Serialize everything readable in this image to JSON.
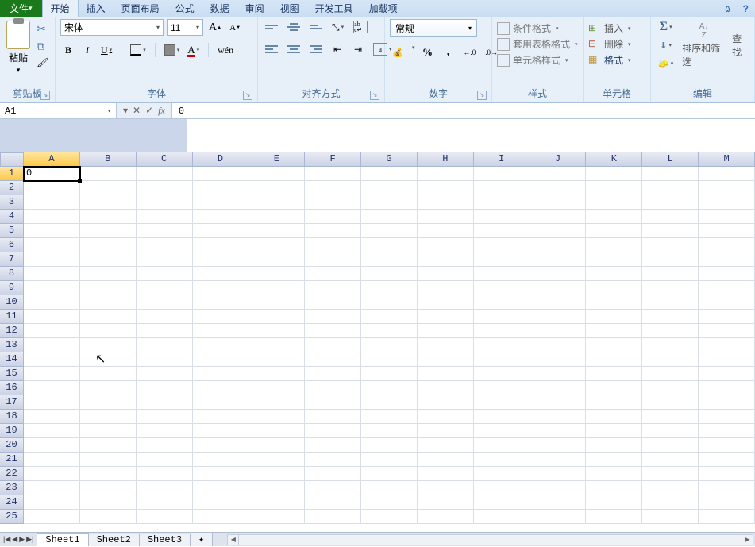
{
  "menu": {
    "file": "文件",
    "tabs": [
      "开始",
      "插入",
      "页面布局",
      "公式",
      "数据",
      "审阅",
      "视图",
      "开发工具",
      "加载项"
    ],
    "active_tab_index": 0
  },
  "ribbon": {
    "clipboard": {
      "paste": "粘贴",
      "label": "剪贴板"
    },
    "font": {
      "name": "宋体",
      "size": "11",
      "bold": "B",
      "italic": "I",
      "underline": "U",
      "wen": "wén",
      "label": "字体"
    },
    "align": {
      "label": "对齐方式"
    },
    "number": {
      "format": "常规",
      "label": "数字"
    },
    "styles": {
      "conditional": "条件格式",
      "table": "套用表格格式",
      "cell": "单元格样式",
      "label": "样式"
    },
    "cells": {
      "insert": "插入",
      "delete": "删除",
      "format": "格式",
      "label": "单元格"
    },
    "edit": {
      "sort": "排序和筛选",
      "find": "查找",
      "label": "编辑"
    }
  },
  "namebox": "A1",
  "formula": "0",
  "grid": {
    "columns": [
      "A",
      "B",
      "C",
      "D",
      "E",
      "F",
      "G",
      "H",
      "I",
      "J",
      "K",
      "L",
      "M"
    ],
    "active_col": 0,
    "rows": 25,
    "active_row": 0,
    "cells": {
      "A1": "0"
    }
  },
  "sheets": {
    "tabs": [
      "Sheet1",
      "Sheet2",
      "Sheet3"
    ],
    "active_index": 0
  }
}
